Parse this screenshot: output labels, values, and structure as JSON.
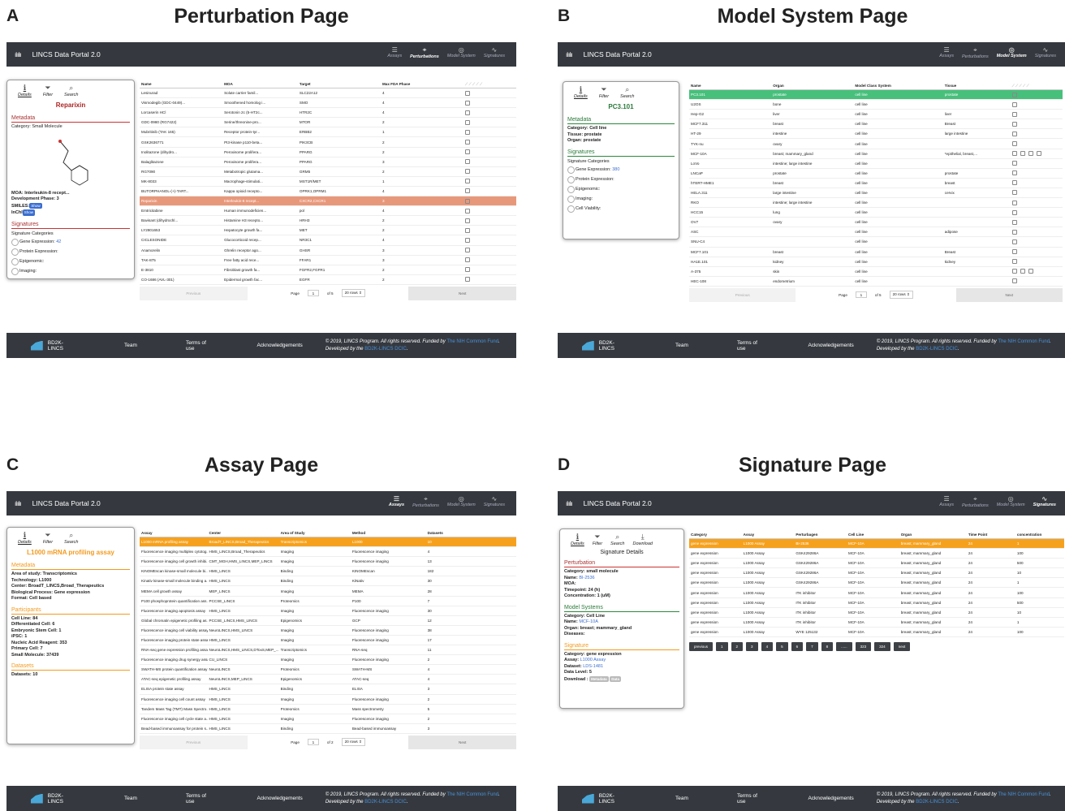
{
  "portal_title": "LINCS Data Portal 2.0",
  "nav": [
    {
      "label": "Assays",
      "icon": "list-icon"
    },
    {
      "label": "Perturbations",
      "icon": "molecule-icon"
    },
    {
      "label": "Model System",
      "icon": "globe-icon"
    },
    {
      "label": "Signatures",
      "icon": "signature-icon"
    }
  ],
  "tabs": {
    "details": "Details",
    "filter": "Filter",
    "search": "Search",
    "download": "Download"
  },
  "footer": {
    "brand": "BD2K-LINCS",
    "team": "Team",
    "terms": "Terms of use",
    "ack": "Acknowledgements",
    "copy1": "© 2019, LINCS Program. All rights reserved. Funded by ",
    "nih": "The NIH Common Fund",
    "copy2": ". Developed by the ",
    "dcic": "BD2K-LINCS DCIC",
    "dot": "."
  },
  "pager": {
    "previous": "Previous",
    "page": "Page",
    "next": "Next",
    "rows": "20 rows ⇕"
  },
  "A": {
    "letter": "A",
    "title": "Perturbation Page",
    "entity": "Reparixin",
    "metadata": "Metadata",
    "category": "Category: Small Molecule",
    "moa": "MOA: Interleukin-8 recept...",
    "phase": "Development Phase: 3",
    "smiles": "SMILES:",
    "inchi": "InChI",
    "show": "Show",
    "signatures": "Signatures",
    "sig_cat": "Signature Categories",
    "gene": "Gene Expression: ",
    "gene_n": "42",
    "protein": "Protein Expression:",
    "epigenomic": "Epigenomic:",
    "imaging": "Imaging:",
    "headers": [
      "Name",
      "MOA",
      "Target",
      "Max FDA Phase"
    ],
    "rows": [
      [
        "Lesinurad",
        "Solute carrier famil...",
        "SLC22A12",
        "4"
      ],
      [
        "Vismodegib (GDC-0449)...",
        "Smoothened homolog i...",
        "SMO",
        "4"
      ],
      [
        "Lorcaserin HCl",
        "Serotonin 2c (5-HT2c...",
        "HTR2C",
        "4"
      ],
      [
        "GDC-0980 (RG7422)",
        "Serine/threonine-pro...",
        "MTOR",
        "2"
      ],
      [
        "Mubritinib (TAK 165)",
        "Receptor protein-tyr...",
        "ERBB2",
        "1"
      ],
      [
        "GSK2636771",
        "PI3-kinase p110-beta...",
        "PIK3CB",
        "2"
      ],
      [
        "Inolitazone (dihydro...",
        "Peroxisome prolifera...",
        "PPARG",
        "2"
      ],
      [
        "Balaglitazone",
        "Peroxisome prolifera...",
        "PPARG",
        "3"
      ],
      [
        "RG7090",
        "Metabotropic glutama...",
        "GRM5",
        "2"
      ],
      [
        "MK-8033",
        "Macrophage-stimulati...",
        "MST1R/MET",
        "1"
      ],
      [
        "BUTORPHANOL-(+)-TART...",
        "Kappa opioid recepto...",
        "OPRK1,OPRM1",
        "4"
      ],
      [
        "Reparixin",
        "Interleukin-8 recept...",
        "CXCR2,CXCR1",
        "3"
      ],
      [
        "Emtricitabine",
        "Human immunodeficien...",
        "pol",
        "4"
      ],
      [
        "Bavisant (dihydrochl...",
        "Histamine H3 recepto...",
        "HRH3",
        "2"
      ],
      [
        "LY2801653",
        "Hepatocyte growth fa...",
        "MET",
        "2"
      ],
      [
        "CICLESONIDE",
        "Glucocorticoid recep...",
        "NR3C1",
        "4"
      ],
      [
        "Anamorelin",
        "Ghrelin receptor ago...",
        "GHSR",
        "3"
      ],
      [
        "TAK-875",
        "Free fatty acid rece...",
        "FFAR1",
        "3"
      ],
      [
        "E-3810",
        "Fibroblast growth fa...",
        "FGFR2,FGFR1",
        "2"
      ],
      [
        "CO-1686 (AVL-301)",
        "Epidermal growth fac...",
        "EGFR",
        "2"
      ]
    ],
    "page_num": "1",
    "of": "of 5"
  },
  "B": {
    "letter": "B",
    "title": "Model System Page",
    "entity": "PC3.101",
    "metadata": "Metadata",
    "category": "Category: Cell line",
    "tissue": "Tissue: prostate",
    "organ": "Organ: prostate",
    "signatures": "Signatures",
    "sig_cat": "Signature Categories",
    "gene": "Gene Expression: ",
    "gene_n": "380",
    "protein": "Protein Expression:",
    "epigenomic": "Epigenomic:",
    "imaging": "Imaging:",
    "viability": "Cell Viability:",
    "headers": [
      "Name",
      "Organ",
      "Model Class System",
      "Tissue"
    ],
    "rows": [
      [
        "PC3.101",
        "prostate",
        "cell line",
        "prostate"
      ],
      [
        "U2OS",
        "bone",
        "cell line",
        ""
      ],
      [
        "Hep-G2",
        "liver",
        "cell line",
        "liver"
      ],
      [
        "MCF7.311",
        "breast",
        "cell line",
        "Breast"
      ],
      [
        "HT-29",
        "intestine",
        "cell line",
        "large intestine"
      ],
      [
        "TYK-nu",
        "ovary",
        "cell line",
        ""
      ],
      [
        "MCF-10A",
        "breast; mammary_gland",
        "cell line",
        "*epithelial, breast,..."
      ],
      [
        "LoVo",
        "intestine; large intestine",
        "cell line",
        ""
      ],
      [
        "LNCaP",
        "prostate",
        "cell line",
        "prostate"
      ],
      [
        "hTERT-HME1",
        "breast",
        "cell line",
        "breast"
      ],
      [
        "HELA.311",
        "large intestine",
        "cell line",
        "cervix"
      ],
      [
        "RKO",
        "intestine; large intestine",
        "cell line",
        ""
      ],
      [
        "HCC15",
        "lung",
        "cell line",
        ""
      ],
      [
        "OV7",
        "ovary",
        "cell line",
        ""
      ],
      [
        "ASC",
        "",
        "cell line",
        "adipose"
      ],
      [
        "SNU-C4",
        "",
        "cell line",
        ""
      ],
      [
        "MCF7.101",
        "breast",
        "cell line",
        "Breast"
      ],
      [
        "HA1E.101",
        "kidney",
        "cell line",
        "kidney"
      ],
      [
        "A-375",
        "skin",
        "cell line",
        ""
      ],
      [
        "HEC-108",
        "endometrium",
        "cell line",
        ""
      ]
    ],
    "page_num": "1",
    "of": "of 5"
  },
  "C": {
    "letter": "C",
    "title": "Assay Page",
    "entity": "L1000 mRNA profiling assay",
    "metadata": "Metadata",
    "area": "Area of study: Transcriptomics",
    "tech": "Technology: L1000",
    "center": "Center: BroadT_LINCS,Broad_Therapeutics",
    "bio": "Biological Process: Gene expression",
    "format": "Format: Cell based",
    "participants": "Participants",
    "p1": "Cell Line: 84",
    "p2": "Differentiated Cell: 6",
    "p3": "Embryonic Stem Cell: 1",
    "p4": "iPSC: 1",
    "p5": "Nucleic Acid Reagent: 353",
    "p6": "Primary Cell: 7",
    "p7": "Small Molecule: 37439",
    "datasets": "Datasets",
    "ds": "Datasets: 10",
    "headers": [
      "Assay",
      "Center",
      "Area of Study",
      "Method",
      "Datasets"
    ],
    "rows": [
      [
        "L1000 mRNA profiling assay",
        "BroadT_LINCS,Broad_Therapeutics",
        "Transcriptomics",
        "L1000",
        "10"
      ],
      [
        "Fluorescence imaging multiplex cytotog...",
        "HMS_LINCS,Broad_Therapeutics",
        "Imaging",
        "Fluorescence imaging",
        "4"
      ],
      [
        "Fluorescence imaging cell growth inhibi...",
        "CMT_MGH,HMS_LINCS,MEP_LINCS",
        "Imaging",
        "Fluorescence imaging",
        "13"
      ],
      [
        "KINOMEscan kinase-small molecule bi...",
        "HMS_LINCS",
        "Binding",
        "KINOMEscan",
        "182"
      ],
      [
        "Kinativ kinase-small molecule binding a...",
        "HMS_LINCS",
        "Binding",
        "KiNativ",
        "30"
      ],
      [
        "MEMA cell growth assay",
        "MEP_LINCS",
        "Imaging",
        "MEMA",
        "28"
      ],
      [
        "P100 phosphoprotein quantification ass...",
        "PCCSE_LINCS",
        "Proteomics",
        "P100",
        "7"
      ],
      [
        "Fluorescence imaging apoptosis assay",
        "HMS_LINCS",
        "Imaging",
        "Fluorescence imaging",
        "30"
      ],
      [
        "Global chromatin epigenetic profiling as...",
        "PCCSE_LINCS,HMS_LINCS",
        "Epigenomics",
        "GCP",
        "12"
      ],
      [
        "Fluorescence imaging cell viability assay",
        "NeuroLINCS,HMS_LINCS",
        "Imaging",
        "Fluorescence imaging",
        "38"
      ],
      [
        "Fluorescence imaging protein state assay",
        "HMS_LINCS",
        "Imaging",
        "Fluorescence imaging",
        "17"
      ],
      [
        "RNA-seq gene expression profiling assay",
        "NeuroLINCS,HMS_LINCS,DToxS,MEP_...",
        "Transcriptomics",
        "RNA-seq",
        "11"
      ],
      [
        "Fluorescence imaging drug synergy assay",
        "CU_LINCS",
        "Imaging",
        "Fluorescence imaging",
        "2"
      ],
      [
        "SWATH-MS protein quantification assay",
        "NeuroLINCS",
        "Proteomics",
        "SWATH-MS",
        "4"
      ],
      [
        "ATAC-seq epigenetic profiling assay",
        "NeuroLINCS,MEP_LINCS",
        "Epigenomics",
        "ATAC-seq",
        "4"
      ],
      [
        "ELISA protein state assay",
        "HMS_LINCS",
        "Binding",
        "ELISA",
        "3"
      ],
      [
        "Fluorescence imaging cell count assay",
        "HMS_LINCS",
        "Imaging",
        "Fluorescence imaging",
        "2"
      ],
      [
        "Tandem Mass Tag (TMT) Mass Spectro...",
        "HMS_LINCS",
        "Proteomics",
        "Mass spectrometry",
        "5"
      ],
      [
        "Fluorescence imaging cell cycle state a...",
        "HMS_LINCS",
        "Imaging",
        "Fluorescence imaging",
        "2"
      ],
      [
        "Bead-based immunoassay for protein s...",
        "HMS_LINCS",
        "Binding",
        "Bead-based immunoassay",
        "3"
      ]
    ],
    "page_num": "1",
    "of": "of 2"
  },
  "D": {
    "letter": "D",
    "title": "Signature Page",
    "entity": "Signature Details",
    "perturbation": "Perturbation",
    "pc": "Category: small molecule",
    "pn": "Name: ",
    "pn_v": "BI-2536",
    "pm": "MOA:",
    "pt": "Timepoint: 24 (h)",
    "pcn": "Concentration: 1 (uM)",
    "model": "Model Systems",
    "mc": "Category: Cell Line",
    "mn": "Name: ",
    "mn_v": "MCF-10A",
    "mo": "Organ: breast; mammary_gland",
    "md": "Diseases:",
    "signature": "Signature",
    "sc": "Category:   gene expression",
    "sa": "Assay:         ",
    "sa_v": "L1000 Assay",
    "sd": "Dataset:     ",
    "sd_v": "LDS-1481",
    "sl": "Data Level:  5",
    "sdl": "Download :",
    "b1": "Metadata",
    "b2": "Data",
    "headers": [
      "Category",
      "Assay",
      "Perturbagen",
      "Cell Line",
      "Organ",
      "Time Point",
      "concentration"
    ],
    "rows": [
      [
        "gene expression",
        "L1000 Assay",
        "BI-2536",
        "MCF-10A",
        "breast; mammary_gland",
        "24",
        "1"
      ],
      [
        "gene expression",
        "L1000 Assay",
        "GSK429286A",
        "MCF-10A",
        "breast; mammary_gland",
        "24",
        "100"
      ],
      [
        "gene expression",
        "L1000 Assay",
        "GSK429286A",
        "MCF-10A",
        "breast; mammary_gland",
        "24",
        "500"
      ],
      [
        "gene expression",
        "L1000 Assay",
        "GSK429286A",
        "MCF-10A",
        "breast; mammary_gland",
        "24",
        "10"
      ],
      [
        "gene expression",
        "L1000 Assay",
        "GSK429286A",
        "MCF-10A",
        "breast; mammary_gland",
        "24",
        "1"
      ],
      [
        "gene expression",
        "L1000 Assay",
        "ITK inhibitor",
        "MCF-10A",
        "breast; mammary_gland",
        "24",
        "100"
      ],
      [
        "gene expression",
        "L1000 Assay",
        "ITK inhibitor",
        "MCF-10A",
        "breast; mammary_gland",
        "24",
        "500"
      ],
      [
        "gene expression",
        "L1000 Assay",
        "ITK inhibitor",
        "MCF-10A",
        "breast; mammary_gland",
        "24",
        "10"
      ],
      [
        "gene expression",
        "L1000 Assay",
        "ITK inhibitor",
        "MCF-10A",
        "breast; mammary_gland",
        "24",
        "1"
      ],
      [
        "gene expression",
        "L1000 Assay",
        "WYE 125132",
        "MCF-10A",
        "breast; mammary_gland",
        "24",
        "100"
      ]
    ],
    "pages": [
      "previous",
      "1",
      "2",
      "3",
      "4",
      "5",
      "6",
      "7",
      "8",
      "......",
      "323",
      "324",
      "next"
    ]
  }
}
